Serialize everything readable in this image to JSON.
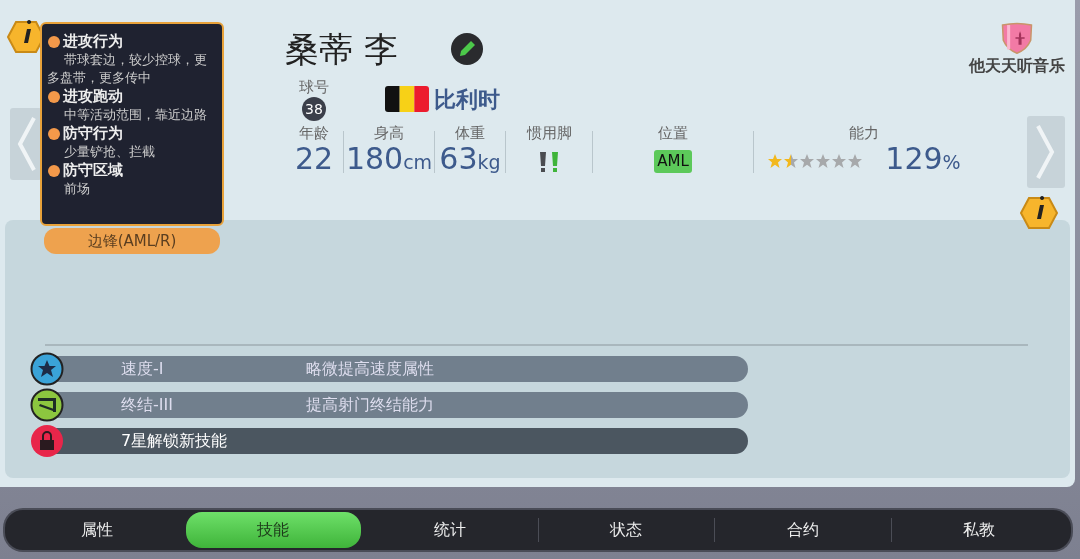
{
  "tooltip": {
    "sections": [
      {
        "title": "进攻行为",
        "text": "带球套边，较少控球，更多盘带，更多传中"
      },
      {
        "title": "进攻跑动",
        "text": "中等活动范围，靠近边路"
      },
      {
        "title": "防守行为",
        "text": "少量铲抢、拦截"
      },
      {
        "title": "防守区域",
        "text": "前场"
      }
    ]
  },
  "position_tag": "边锋(AML/R)",
  "player": {
    "name": "桑蒂 李",
    "number_label": "球号",
    "number": "38",
    "nationality": "比利时",
    "club": "他天天听音乐",
    "stats": [
      {
        "kind": "value",
        "label": "年龄",
        "value": "22"
      },
      {
        "kind": "value",
        "label": "身高",
        "value": "180",
        "unit": "cm"
      },
      {
        "kind": "value",
        "label": "体重",
        "value": "63",
        "unit": "kg"
      },
      {
        "kind": "foot",
        "label": "惯用脚",
        "left": false,
        "right": true
      },
      {
        "kind": "position",
        "label": "位置",
        "value": "AML"
      },
      {
        "kind": "ability",
        "label": "能力",
        "stars": 1.5,
        "value": "129",
        "unit": "%"
      }
    ]
  },
  "skills": [
    {
      "kind": "speed",
      "name": "速度-I",
      "description": "略微提高速度属性"
    },
    {
      "kind": "finishing",
      "name": "终结-III",
      "description": "提高射门终结能力"
    },
    {
      "kind": "locked",
      "name": "7星解锁新技能"
    }
  ],
  "tabs": [
    {
      "label": "属性",
      "selected": false
    },
    {
      "label": "技能",
      "selected": true
    },
    {
      "label": "统计",
      "selected": false
    },
    {
      "label": "状态",
      "selected": false
    },
    {
      "label": "合约",
      "selected": false
    },
    {
      "label": "私教",
      "selected": false
    }
  ]
}
